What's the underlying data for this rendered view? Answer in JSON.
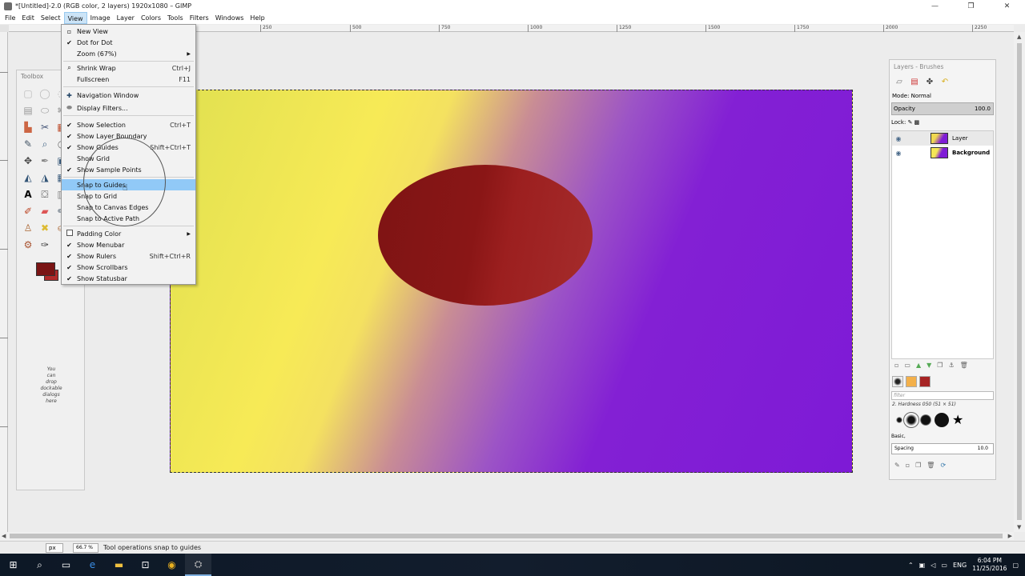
{
  "window": {
    "title": "*[Untitled]-2.0 (RGB color, 2 layers) 1920x1080 – GIMP",
    "minimize": "—",
    "maximize": "❐",
    "close": "✕"
  },
  "menubar": [
    "File",
    "Edit",
    "Select",
    "View",
    "Image",
    "Layer",
    "Colors",
    "Tools",
    "Filters",
    "Windows",
    "Help"
  ],
  "ruler": {
    "labels": [
      "250",
      "500",
      "750",
      "1000",
      "1250",
      "1500",
      "1750",
      "2000",
      "2250"
    ]
  },
  "view_menu": {
    "items": {
      "new_view": "New View",
      "dot_for_dot": "Dot for Dot",
      "zoom": "Zoom (67%)",
      "shrink_wrap": "Shrink Wrap",
      "shrink_wrap_accel": "Ctrl+J",
      "fullscreen": "Fullscreen",
      "fullscreen_accel": "F11",
      "navigation_window": "Navigation Window",
      "display_filters": "Display Filters...",
      "show_selection": "Show Selection",
      "show_selection_accel": "Ctrl+T",
      "show_layer_boundary": "Show Layer Boundary",
      "show_guides": "Show Guides",
      "show_guides_accel": "Shift+Ctrl+T",
      "show_grid": "Show Grid",
      "show_sample_points": "Show Sample Points",
      "snap_to_guides": "Snap to Guides",
      "snap_to_grid": "Snap to Grid",
      "snap_to_canvas_edges": "Snap to Canvas Edges",
      "snap_to_active_path": "Snap to Active Path",
      "padding_color": "Padding Color",
      "show_menubar": "Show Menubar",
      "show_rulers": "Show Rulers",
      "show_rulers_accel": "Shift+Ctrl+R",
      "show_scrollbars": "Show Scrollbars",
      "show_statusbar": "Show Statusbar"
    }
  },
  "toolbox": {
    "title": "Toolbox",
    "drop_hint": [
      "You",
      "can",
      "drop",
      "dockable",
      "dialogs",
      "here"
    ]
  },
  "layers_dock": {
    "title": "Layers - Brushes",
    "mode": "Mode: Normal",
    "opacity_label": "Opacity",
    "opacity_value": "100.0",
    "lock_label": "Lock:",
    "layers": [
      "Layer",
      "Background"
    ],
    "filter_placeholder": "filter",
    "brush_name": "2. Hardness 050 (51 × 51)",
    "brush_group": "Basic,",
    "spacing_label": "Spacing",
    "spacing_value": "10.0"
  },
  "statusbar": {
    "unit": "px",
    "zoom": "66.7 %",
    "message": "Tool operations snap to guides"
  },
  "taskbar": {
    "time": "6:04 PM",
    "date": "11/25/2016",
    "language": "ENG"
  },
  "colors": {
    "foreground": "#7a1414",
    "background": "#b22a2a",
    "menu_highlight": "#91c9f7"
  }
}
